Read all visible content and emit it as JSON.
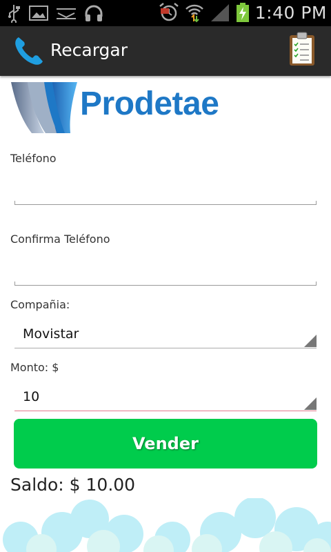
{
  "status_bar": {
    "time": "1:40 PM",
    "icons_left": [
      "usb-icon",
      "image-icon",
      "voicemail-icon",
      "headphones-icon"
    ],
    "icons_right": [
      "alarm-icon",
      "wifi-icon",
      "signal-icon",
      "battery-charging-icon"
    ]
  },
  "action_bar": {
    "title": "Recargar",
    "icon": "phone-icon",
    "action_icon": "clipboard-icon"
  },
  "logo": {
    "text": "Prodetae"
  },
  "form": {
    "telefono_label": "Teléfono",
    "telefono_value": "",
    "confirma_label": "Confirma Teléfono",
    "confirma_value": "",
    "compania_label": "Compañia:",
    "compania_selected": "Movistar",
    "monto_label": "Monto: $",
    "monto_selected": "10",
    "submit_label": "Vender"
  },
  "saldo": "Saldo: $ 10.00",
  "colors": {
    "accent_green": "#00cc4c",
    "logo_blue": "#1e78c6",
    "phone_blue": "#1f9ee0",
    "action_bar": "#2a2a2a"
  }
}
